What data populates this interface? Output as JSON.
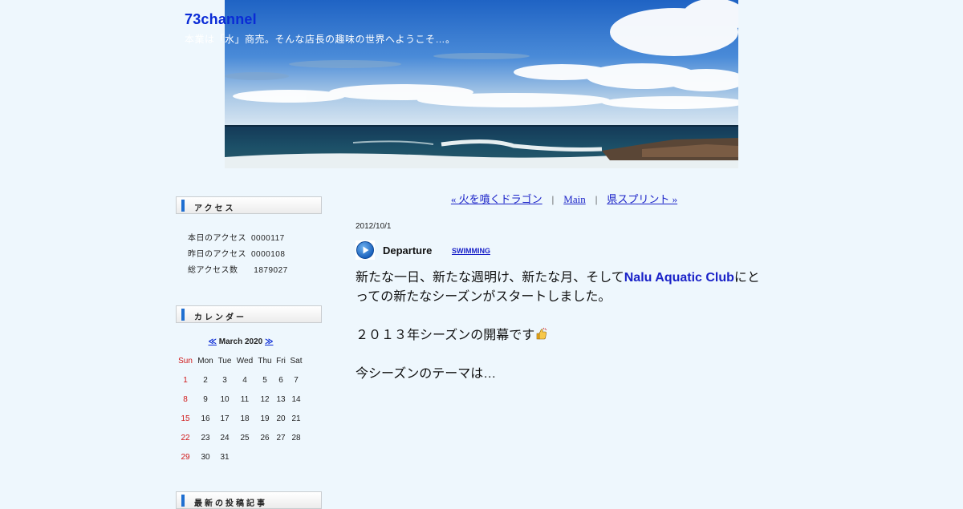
{
  "site": {
    "title": "73channel",
    "description": "本業は「水」商売。そんな店長の趣味の世界へようこそ…。"
  },
  "sidebar": {
    "access": {
      "heading": "アクセス",
      "rows": [
        {
          "label": "本日のアクセス",
          "value": "0000117"
        },
        {
          "label": "昨日のアクセス",
          "value": "0000108"
        },
        {
          "label": "総アクセス数",
          "value": " 1879027"
        }
      ]
    },
    "calendar": {
      "heading": "カレンダー",
      "prev": "≪",
      "month": "March 2020",
      "next": "≫",
      "weekdays": [
        "Sun",
        "Mon",
        "Tue",
        "Wed",
        "Thu",
        "Fri",
        "Sat"
      ],
      "weeks": [
        [
          "1",
          "2",
          "3",
          "4",
          "5",
          "6",
          "7"
        ],
        [
          "8",
          "9",
          "10",
          "11",
          "12",
          "13",
          "14"
        ],
        [
          "15",
          "16",
          "17",
          "18",
          "19",
          "20",
          "21"
        ],
        [
          "22",
          "23",
          "24",
          "25",
          "26",
          "27",
          "28"
        ],
        [
          "29",
          "30",
          "31",
          "",
          "",
          "",
          ""
        ]
      ]
    },
    "recent": {
      "heading": "最新の投稿記事"
    }
  },
  "pager": {
    "prev": "« 火を噴くドラゴン",
    "sep1": "|",
    "main": "Main",
    "sep2": "|",
    "next": "県スプリント »"
  },
  "post": {
    "date": "2012/10/1",
    "title": "Departure",
    "category": "SWIMMING",
    "line1_pre": "新たな一日、新たな週明け、新たな月、そして",
    "line1_link": "Nalu Aquatic Club",
    "line1_post": "にとっての新たなシーズンがスタートしました。",
    "line2": "２０１３年シーズンの開幕です",
    "line3": "今シーズンのテーマは…"
  },
  "colors": {
    "background": "#eef7fd",
    "link": "#1a22c8",
    "title": "#0a2bd6",
    "sunday": "#d01818",
    "accent_bar": "#1f6fd1"
  }
}
